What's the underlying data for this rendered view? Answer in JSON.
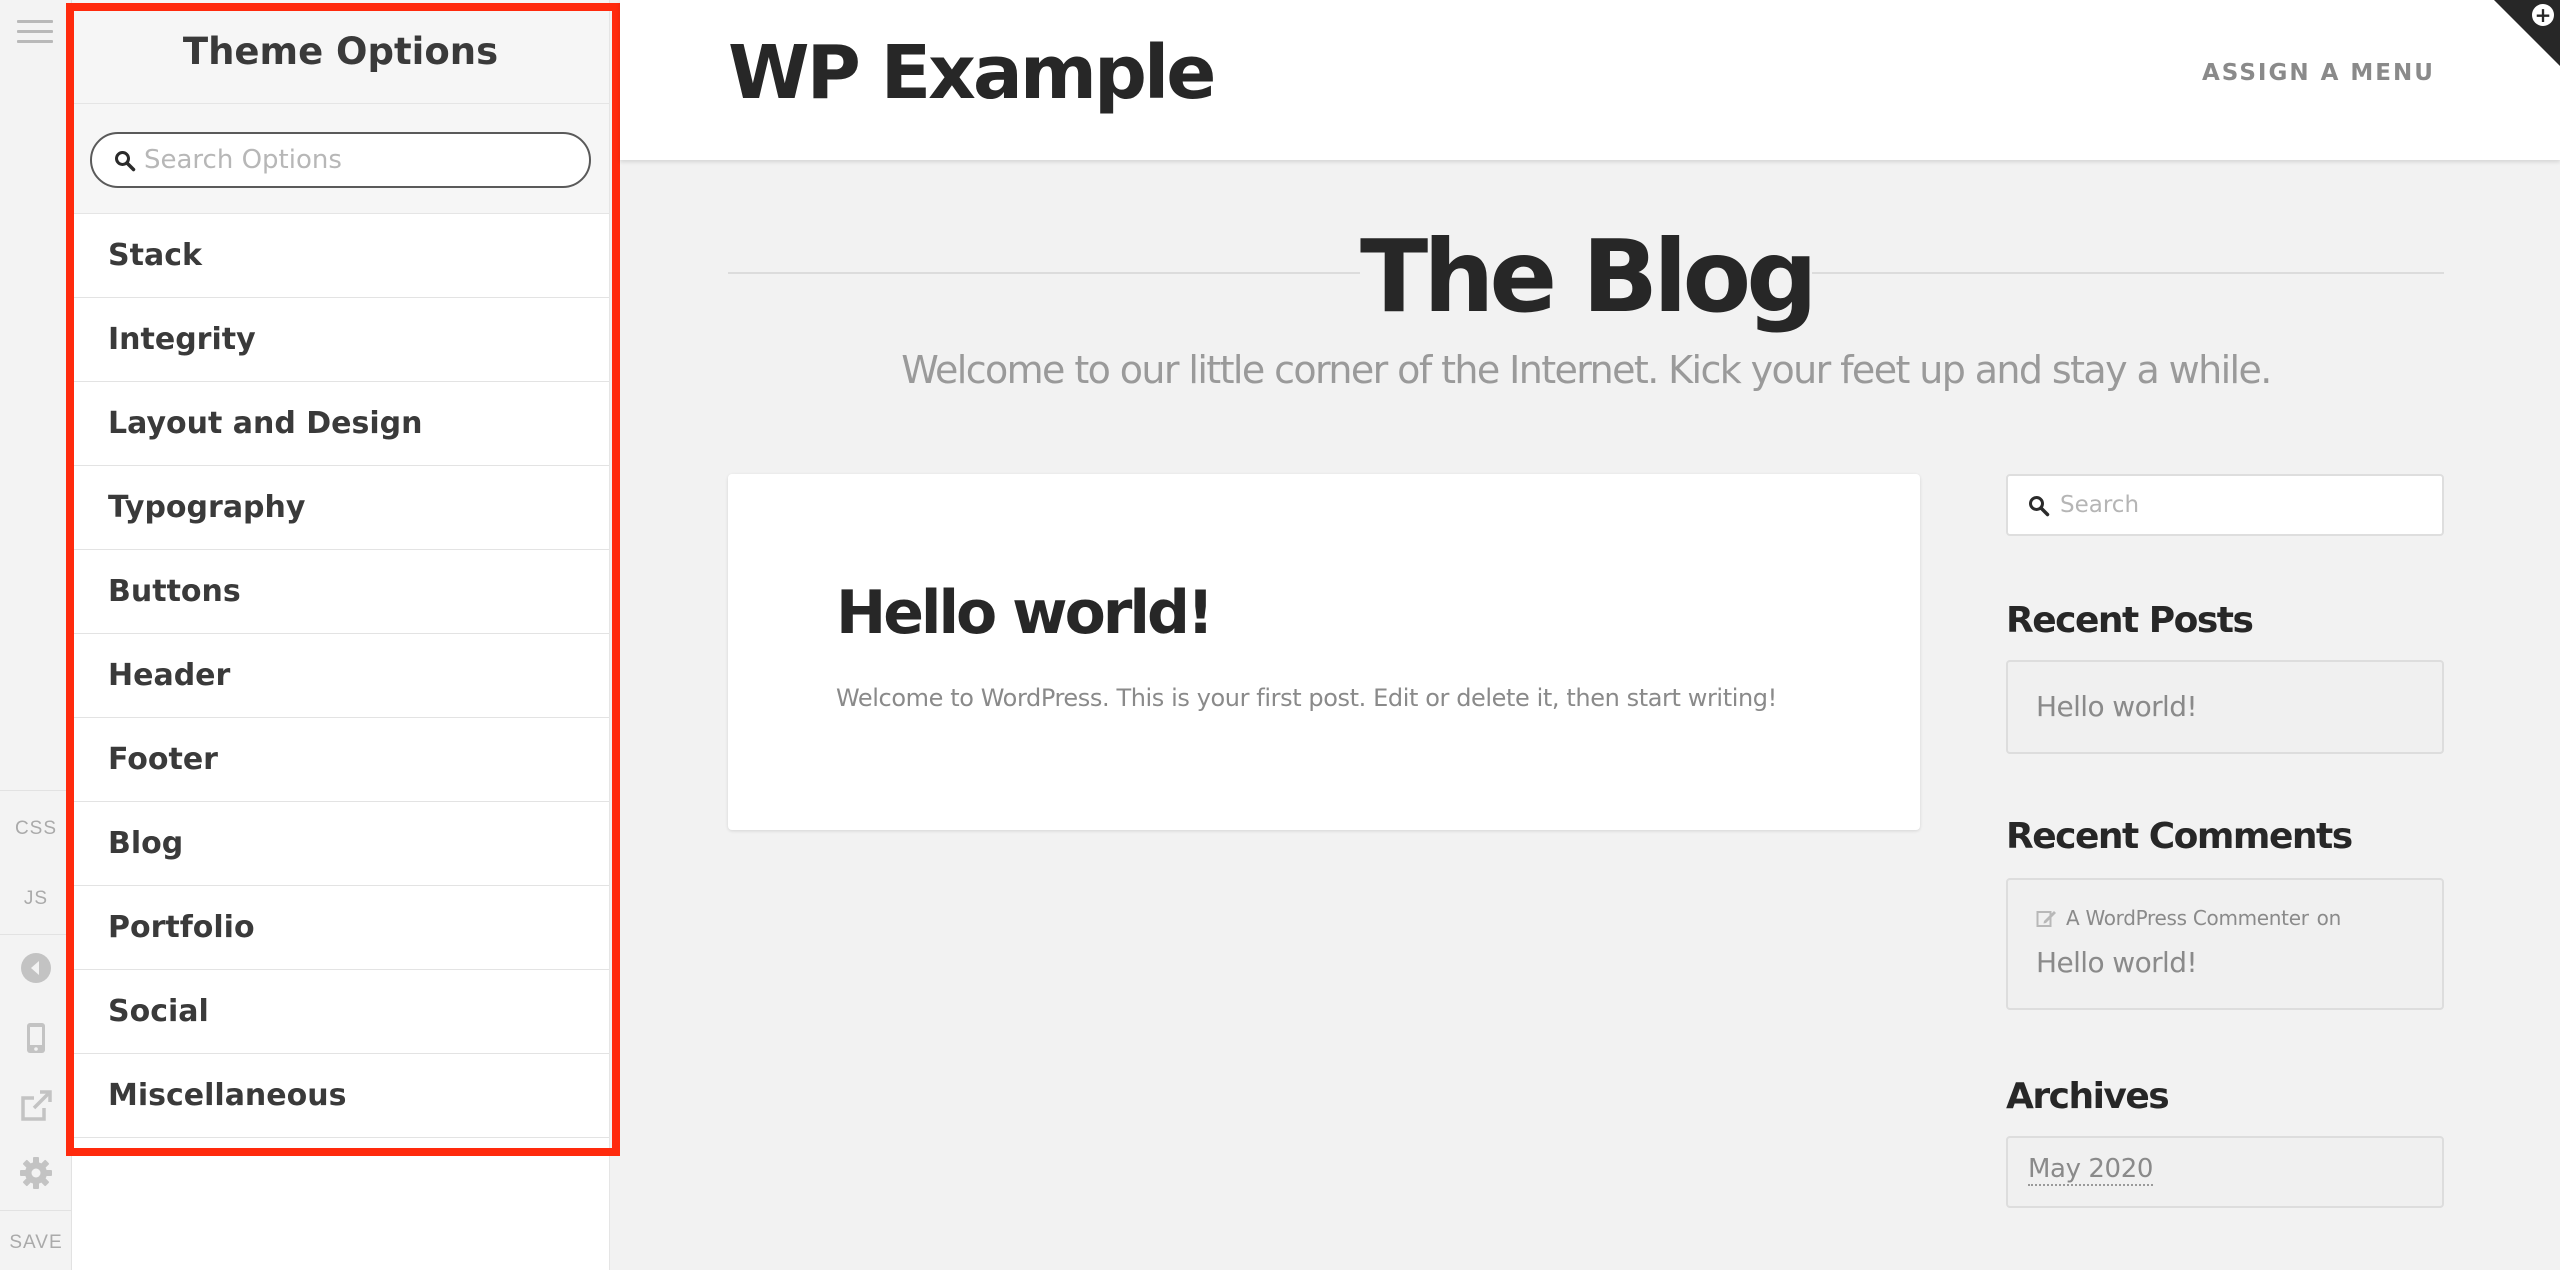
{
  "rail": {
    "menu_icon": "hamburger-icon",
    "css_label": "CSS",
    "js_label": "JS",
    "back_icon": "back-circle-icon",
    "device_icon": "mobile-device-icon",
    "external_icon": "external-link-icon",
    "settings_icon": "gear-icon",
    "save_label": "SAVE"
  },
  "panel": {
    "title": "Theme Options",
    "search_placeholder": "Search Options",
    "items": [
      {
        "label": "Stack"
      },
      {
        "label": "Integrity"
      },
      {
        "label": "Layout and Design"
      },
      {
        "label": "Typography"
      },
      {
        "label": "Buttons"
      },
      {
        "label": "Header"
      },
      {
        "label": "Footer"
      },
      {
        "label": "Blog"
      },
      {
        "label": "Portfolio"
      },
      {
        "label": "Social"
      },
      {
        "label": "Miscellaneous"
      }
    ]
  },
  "site": {
    "title": "WP Example",
    "nav_label": "ASSIGN A MENU",
    "blog_title": "The Blog",
    "blog_subtitle": "Welcome to our little corner of the Internet. Kick your feet up and stay a while.",
    "post": {
      "title": "Hello world!",
      "excerpt": "Welcome to WordPress. This is your first post. Edit or delete it, then start writing!"
    },
    "sidebar": {
      "search_placeholder": "Search",
      "recent_posts_title": "Recent Posts",
      "recent_posts": [
        "Hello world!"
      ],
      "recent_comments_title": "Recent Comments",
      "comment_author": "A WordPress Commenter",
      "comment_on": "on",
      "comment_post": "Hello world!",
      "archives_title": "Archives",
      "archive_month": "May 2020"
    }
  },
  "colors": {
    "highlight": "#ff2a0d",
    "text_dark": "#272727",
    "text_muted": "#8a8a8a",
    "background": "#f2f2f2"
  }
}
